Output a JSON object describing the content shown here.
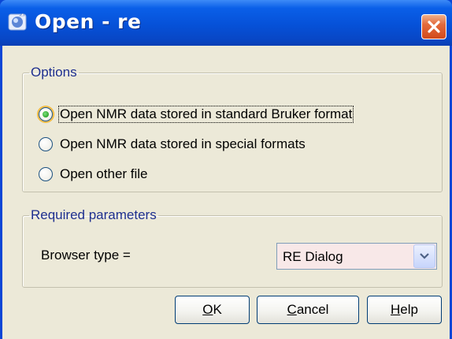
{
  "window": {
    "title": "Open - re",
    "title_icon": "app-icon",
    "close_icon": "close-icon"
  },
  "options": {
    "legend": "Options",
    "radios": [
      {
        "label": "Open NMR data stored in standard Bruker format",
        "checked": true
      },
      {
        "label": "Open NMR data stored in special formats",
        "checked": false
      },
      {
        "label": "Open other file",
        "checked": false
      }
    ]
  },
  "required": {
    "legend": "Required parameters",
    "browser_label": "Browser type =",
    "browser_value": "RE Dialog"
  },
  "buttons": {
    "ok": {
      "mnemonic": "O",
      "rest": "K"
    },
    "cancel": {
      "mnemonic": "C",
      "rest": "ancel"
    },
    "help": {
      "mnemonic": "H",
      "rest": "elp"
    }
  },
  "colors": {
    "titlebar": "#0651d8",
    "close_button": "#d24a1c",
    "dialog_background": "#ece9d8",
    "group_legend": "#1e2f8f",
    "radio_checked": "#2fa52f",
    "combo_background": "#f8e8e8"
  }
}
